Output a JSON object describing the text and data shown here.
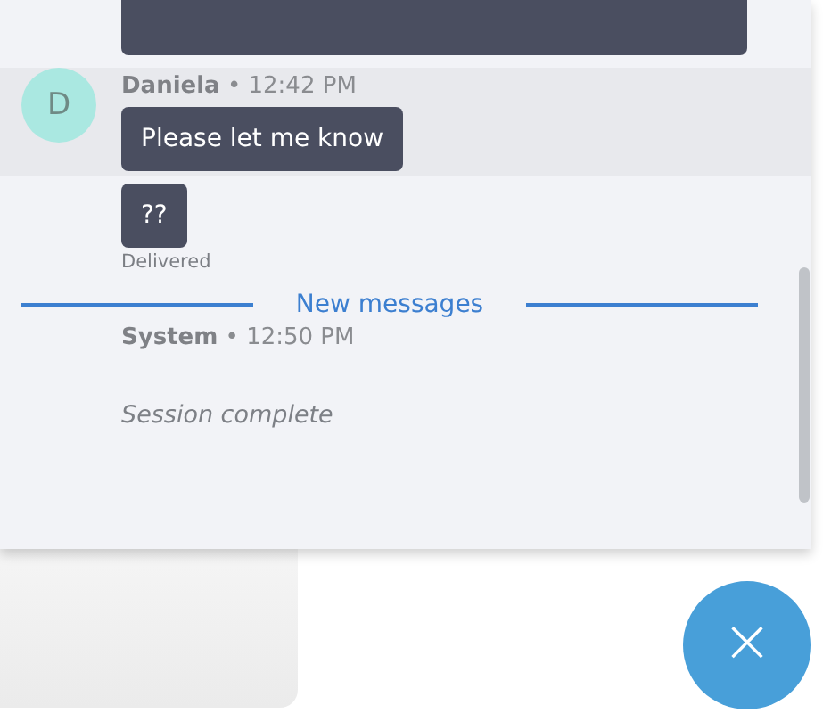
{
  "messages": [
    {
      "kind": "cut-off-bubble"
    },
    {
      "kind": "user",
      "avatar": "D",
      "sender": "Daniela",
      "separator": "•",
      "time": "12:42 PM",
      "bubbles": [
        "Please let me know"
      ]
    },
    {
      "kind": "bubble-only",
      "bubbles": [
        "??"
      ],
      "status": "Delivered"
    },
    {
      "kind": "divider",
      "label": "New messages"
    },
    {
      "kind": "system",
      "sender": "System",
      "separator": "•",
      "time": "12:50 PM",
      "text": "Session complete"
    }
  ],
  "close_button": {
    "label": "×"
  }
}
